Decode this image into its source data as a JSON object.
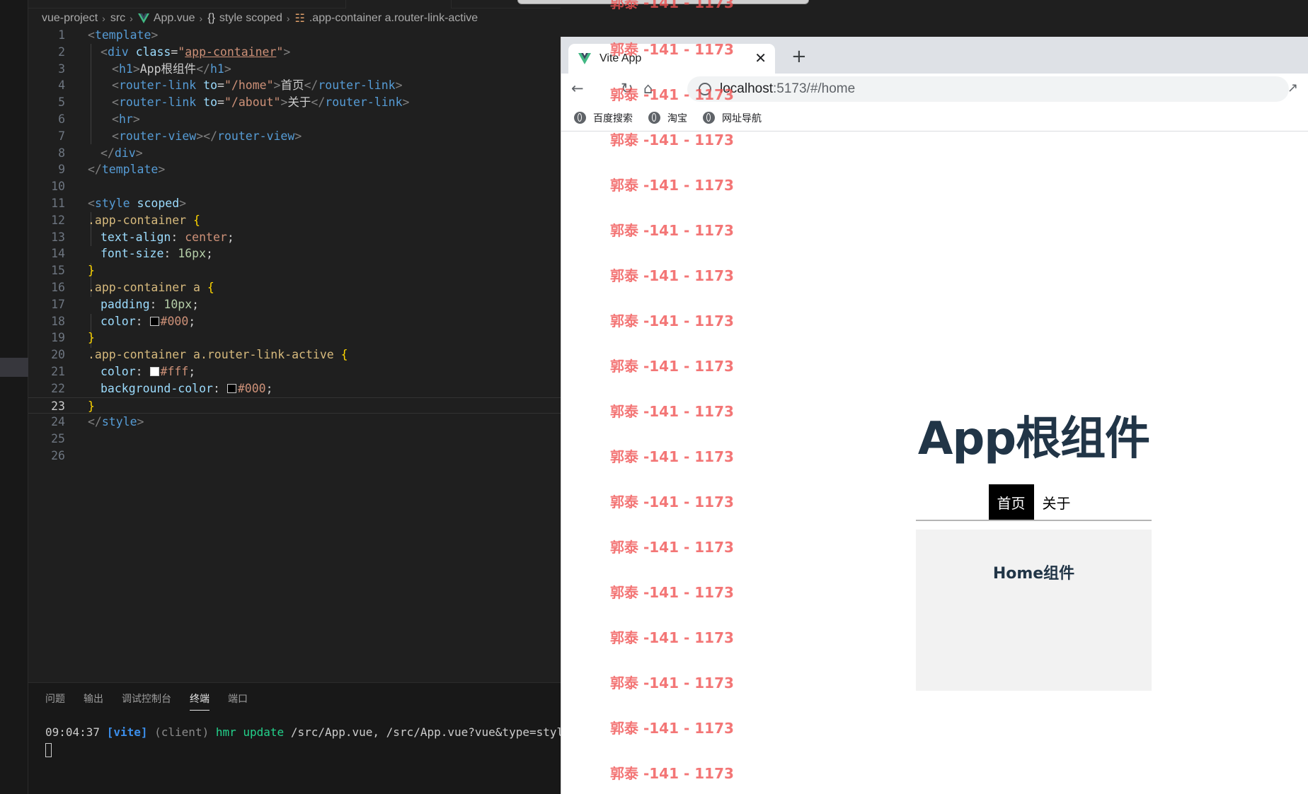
{
  "breadcrumb": {
    "items": [
      "vue-project",
      "src",
      "App.vue",
      "style scoped",
      ".app-container a.router-link-active"
    ]
  },
  "editor": {
    "active_line": 23,
    "line_numbers": [
      "1",
      "2",
      "3",
      "4",
      "5",
      "6",
      "7",
      "8",
      "9",
      "10",
      "11",
      "12",
      "13",
      "14",
      "15",
      "16",
      "17",
      "18",
      "19",
      "20",
      "21",
      "22",
      "23",
      "24",
      "25",
      "26"
    ],
    "code": {
      "l1": [
        "<",
        "template",
        ">"
      ],
      "l2": [
        "<",
        "div",
        " ",
        "class",
        "=",
        "\"",
        "app-container",
        "\"",
        ">"
      ],
      "l3": [
        "<",
        "h1",
        ">",
        "App根组件",
        "</",
        "h1",
        ">"
      ],
      "l4": [
        "<",
        "router-link",
        " ",
        "to",
        "=",
        "\"/home\"",
        ">",
        "首页",
        "</",
        "router-link",
        ">"
      ],
      "l5": [
        "<",
        "router-link",
        " ",
        "to",
        "=",
        "\"/about\"",
        ">",
        "关于",
        "</",
        "router-link",
        ">"
      ],
      "l6": [
        "<",
        "hr",
        ">"
      ],
      "l7": [
        "<",
        "router-view",
        "></",
        "router-view",
        ">"
      ],
      "l8": [
        "</",
        "div",
        ">"
      ],
      "l9": [
        "</",
        "template",
        ">"
      ],
      "l11": [
        "<",
        "style",
        " ",
        "scoped",
        ">"
      ],
      "l12": [
        ".app-container",
        " ",
        "{"
      ],
      "l13": [
        "text-align",
        ": ",
        "center",
        ";"
      ],
      "l14": [
        "font-size",
        ": ",
        "16px",
        ";"
      ],
      "l15": [
        "}"
      ],
      "l16": [
        ".app-container a",
        " ",
        "{"
      ],
      "l17": [
        "padding",
        ": ",
        "10px",
        ";"
      ],
      "l18": [
        "color",
        ": ",
        "#000",
        ";"
      ],
      "l19": [
        "}"
      ],
      "l20": [
        ".app-container a.router-link-active",
        " ",
        "{"
      ],
      "l21": [
        "color",
        ": ",
        "#fff",
        ";"
      ],
      "l22": [
        "background-color",
        ": ",
        "#000",
        ";"
      ],
      "l23": [
        "}"
      ],
      "l24": [
        "</",
        "style",
        ">"
      ]
    },
    "swatches": {
      "l18": "#000000",
      "l21": "#ffffff",
      "l22": "#000000"
    }
  },
  "panel": {
    "tabs": [
      "问题",
      "输出",
      "调试控制台",
      "终端",
      "端口"
    ],
    "active_tab": "终端",
    "terminal": {
      "time": "09:04:37",
      "tag": "[vite]",
      "client": "(client)",
      "hmr": "hmr update",
      "files": "/src/App.vue, /src/App.vue?vue&type=style&ind"
    }
  },
  "browser": {
    "tab_title": "Vite App",
    "url_host": "localhost",
    "url_rest": ":5173/#/home",
    "bookmarks": [
      "百度搜索",
      "淘宝",
      "网址导航"
    ],
    "page": {
      "heading": "App根组件",
      "nav": [
        {
          "label": "首页",
          "active": true
        },
        {
          "label": "关于",
          "active": false
        }
      ],
      "home_title": "Home组件"
    }
  },
  "watermark": {
    "text": "郭泰 -141 - 1173",
    "color": "#f05050"
  },
  "colors": {
    "editor_bg": "#1f1f1f",
    "tag_blue": "#569cd6",
    "string_orange": "#ce9178",
    "heading_navy": "#213547"
  }
}
